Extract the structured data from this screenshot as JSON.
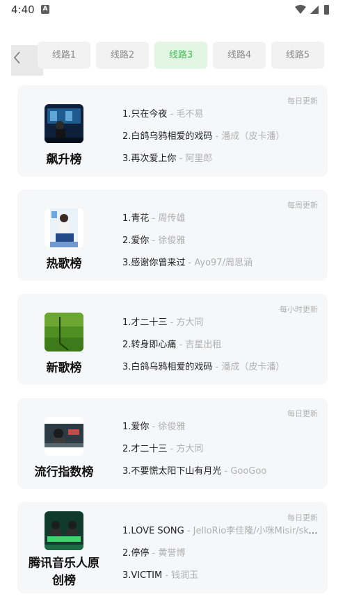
{
  "status_bar": {
    "time": "4:40",
    "notification_icon": "A"
  },
  "tabs": [
    {
      "label": "线路1",
      "active": false
    },
    {
      "label": "线路2",
      "active": false
    },
    {
      "label": "线路3",
      "active": true
    },
    {
      "label": "线路4",
      "active": false
    },
    {
      "label": "线路5",
      "active": false
    }
  ],
  "cards": [
    {
      "title": "飙升榜",
      "update": "每日更新",
      "songs": [
        {
          "rank_title": "1.只在今夜",
          "artist": " - 毛不易"
        },
        {
          "rank_title": "2.白鸽乌鸦相爱的戏码",
          "artist": " - 潘成（皮卡潘）"
        },
        {
          "rank_title": "3.再次爱上你",
          "artist": " - 阿里郎"
        }
      ]
    },
    {
      "title": "热歌榜",
      "update": "每周更新",
      "songs": [
        {
          "rank_title": "1.青花",
          "artist": " - 周传雄"
        },
        {
          "rank_title": "2.爱你",
          "artist": " - 徐俊雅"
        },
        {
          "rank_title": "3.感谢你曾来过",
          "artist": " - Ayo97/周思涵"
        }
      ]
    },
    {
      "title": "新歌榜",
      "update": "每小时更新",
      "songs": [
        {
          "rank_title": "1.才二十三",
          "artist": " - 方大同"
        },
        {
          "rank_title": "2.转身即心痛",
          "artist": " - 吉星出租"
        },
        {
          "rank_title": "3.白鸽乌鸦相爱的戏码",
          "artist": " - 潘成（皮卡潘）"
        }
      ]
    },
    {
      "title": "流行指数榜",
      "update": "每日更新",
      "songs": [
        {
          "rank_title": "1.爱你",
          "artist": " - 徐俊雅"
        },
        {
          "rank_title": "2.才二十三",
          "artist": " - 方大同"
        },
        {
          "rank_title": "3.不要慌太阳下山有月光",
          "artist": " - GooGoo"
        }
      ]
    },
    {
      "title": "腾讯音乐人原创榜",
      "update": "每日更新",
      "songs": [
        {
          "rank_title": "1.LOVE SONG",
          "artist": " - JelloRio李佳隆/小咪Misir/skysli..."
        },
        {
          "rank_title": "2.停停",
          "artist": " - 黄誉博"
        },
        {
          "rank_title": "3.VICTIM",
          "artist": " - 钱润玉"
        }
      ]
    }
  ],
  "colors": {
    "accent": "#3cbf55",
    "accent_bg": "#e2f6e3",
    "card_bg": "#f6f7f9",
    "artist_text": "#b0b0b0"
  }
}
